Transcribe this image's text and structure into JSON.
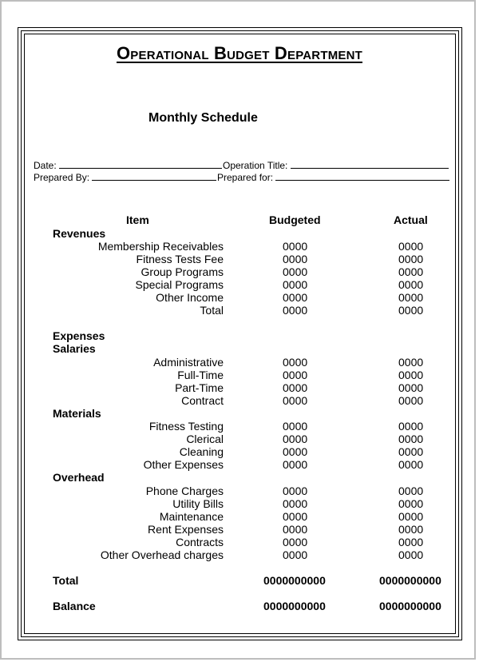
{
  "document": {
    "title": "Operational Budget Department",
    "subtitle": "Monthly Schedule",
    "fields": {
      "date_label": "Date:",
      "operation_title_label": "Operation Title:",
      "prepared_by_label": "Prepared By:",
      "prepared_for_label": "Prepared for:"
    },
    "columns": {
      "item": "Item",
      "budgeted": "Budgeted",
      "actual": "Actual"
    },
    "sections": {
      "revenues": "Revenues",
      "expenses": "Expenses",
      "salaries": "Salaries",
      "materials": "Materials",
      "overhead": "Overhead"
    },
    "revenues": [
      {
        "item": "Membership Receivables",
        "budgeted": "0000",
        "actual": "0000"
      },
      {
        "item": "Fitness Tests Fee",
        "budgeted": "0000",
        "actual": "0000"
      },
      {
        "item": "Group Programs",
        "budgeted": "0000",
        "actual": "0000"
      },
      {
        "item": "Special Programs",
        "budgeted": "0000",
        "actual": "0000"
      },
      {
        "item": "Other Income",
        "budgeted": "0000",
        "actual": "0000"
      },
      {
        "item": "Total",
        "budgeted": "0000",
        "actual": "0000"
      }
    ],
    "salaries": [
      {
        "item": "Administrative",
        "budgeted": "0000",
        "actual": "0000"
      },
      {
        "item": "Full-Time",
        "budgeted": "0000",
        "actual": "0000"
      },
      {
        "item": "Part-Time",
        "budgeted": "0000",
        "actual": "0000"
      },
      {
        "item": "Contract",
        "budgeted": "0000",
        "actual": "0000"
      }
    ],
    "materials": [
      {
        "item": "Fitness Testing",
        "budgeted": "0000",
        "actual": "0000"
      },
      {
        "item": "Clerical",
        "budgeted": "0000",
        "actual": "0000"
      },
      {
        "item": "Cleaning",
        "budgeted": "0000",
        "actual": "0000"
      },
      {
        "item": "Other Expenses",
        "budgeted": "0000",
        "actual": "0000"
      }
    ],
    "overhead": [
      {
        "item": "Phone Charges",
        "budgeted": "0000",
        "actual": "0000"
      },
      {
        "item": "Utility Bills",
        "budgeted": "0000",
        "actual": "0000"
      },
      {
        "item": "Maintenance",
        "budgeted": "0000",
        "actual": "0000"
      },
      {
        "item": "Rent Expenses",
        "budgeted": "0000",
        "actual": "0000"
      },
      {
        "item": "Contracts",
        "budgeted": "0000",
        "actual": "0000"
      },
      {
        "item": "Other Overhead charges",
        "budgeted": "0000",
        "actual": "0000"
      }
    ],
    "total": {
      "label": "Total",
      "budgeted": "0000000000",
      "actual": "0000000000"
    },
    "balance": {
      "label": "Balance",
      "budgeted": "0000000000",
      "actual": "0000000000"
    }
  }
}
